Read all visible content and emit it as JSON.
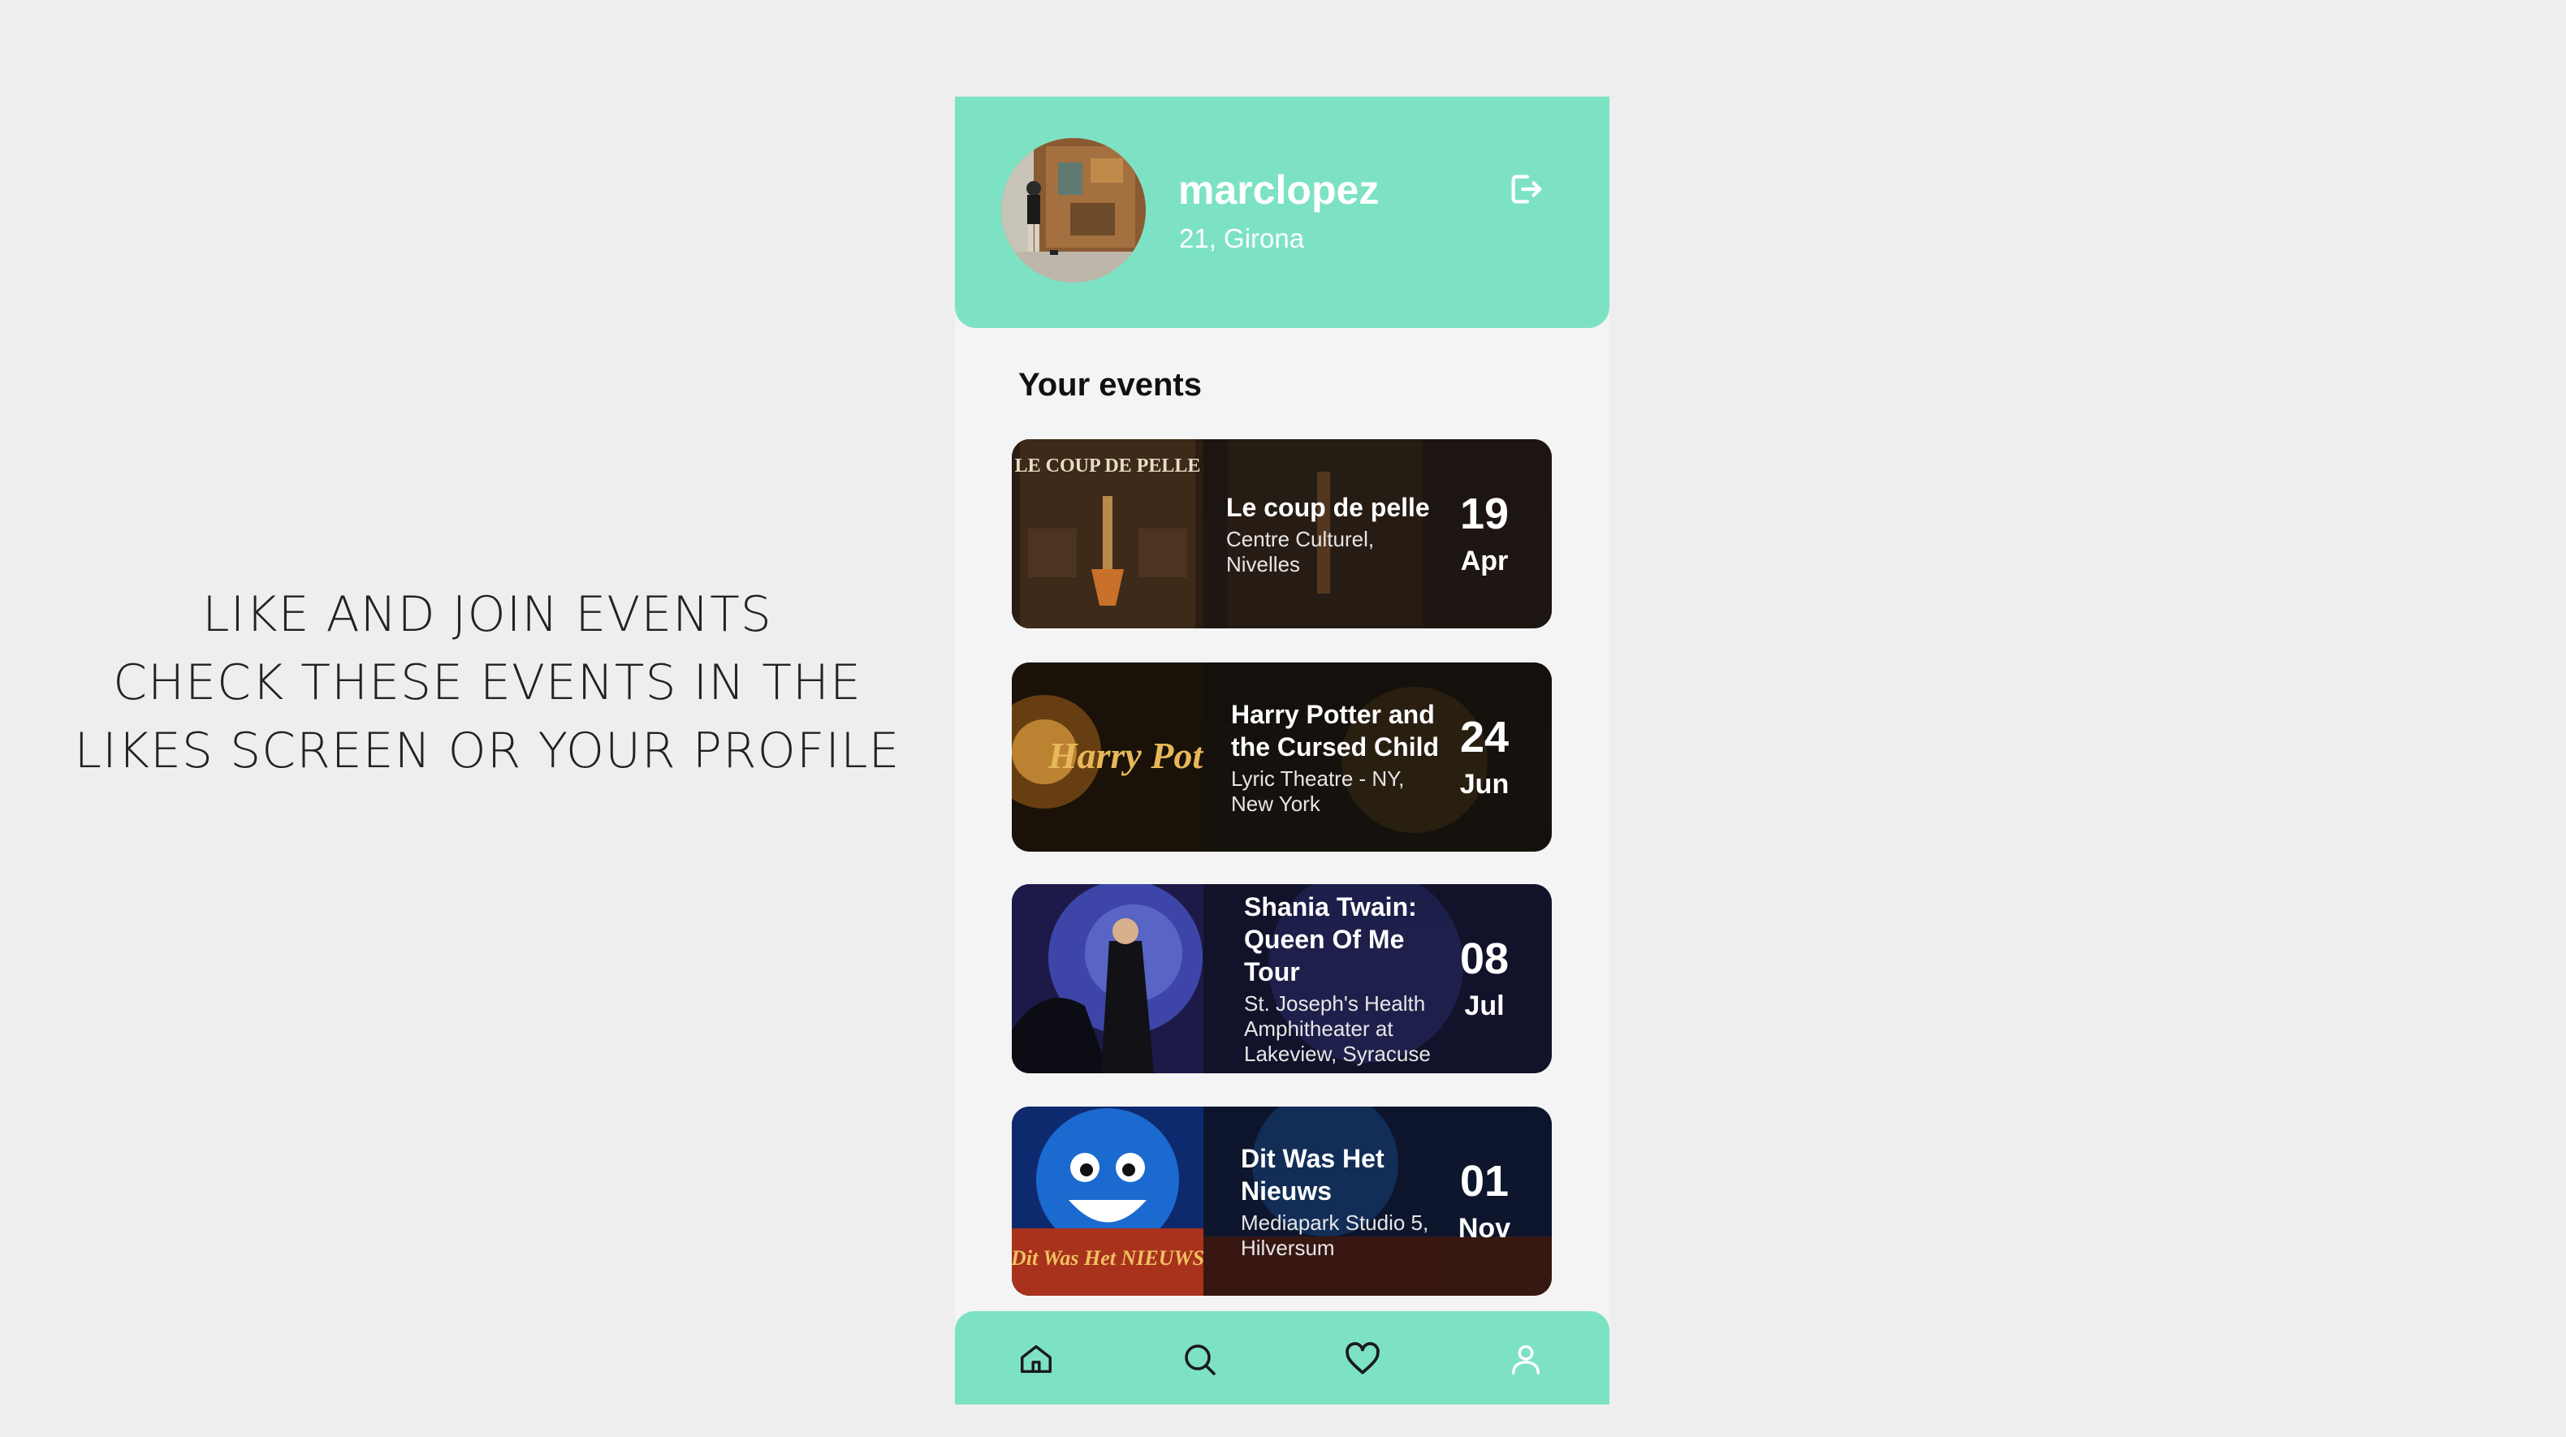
{
  "caption": {
    "line1": "LIKE AND JOIN EVENTS",
    "line2": "CHECK THESE EVENTS IN THE",
    "line3": "LIKES SCREEN OR YOUR PROFILE"
  },
  "profile": {
    "username": "marclopez",
    "info": "21, Girona",
    "logout_icon": "logout-icon"
  },
  "events_section": {
    "title": "Your events",
    "events": [
      {
        "title": "Le coup de pelle",
        "venue": "Centre Culturel, Nivelles",
        "day": "19",
        "month": "Apr",
        "poster_text": "LE COUP DE PELLE"
      },
      {
        "title": "Harry Potter and the Cursed Child",
        "venue": "Lyric Theatre - NY, New York",
        "day": "24",
        "month": "Jun",
        "poster_text": "Harry Pot"
      },
      {
        "title": "Shania Twain: Queen Of Me Tour",
        "venue": "St. Joseph's Health Amphitheater at Lakeview, Syracuse",
        "day": "08",
        "month": "Jul"
      },
      {
        "title": "Dit Was Het Nieuws",
        "venue": "Mediapark Studio 5, Hilversum",
        "day": "01",
        "month": "Nov",
        "poster_text": "Dit Was Het NIEUWS"
      }
    ]
  },
  "nav": {
    "items": [
      "home-icon",
      "search-icon",
      "heart-icon",
      "user-icon"
    ]
  },
  "colors": {
    "accent": "#7de2c4",
    "background": "#eeeeee",
    "card": "#0f0f12"
  }
}
